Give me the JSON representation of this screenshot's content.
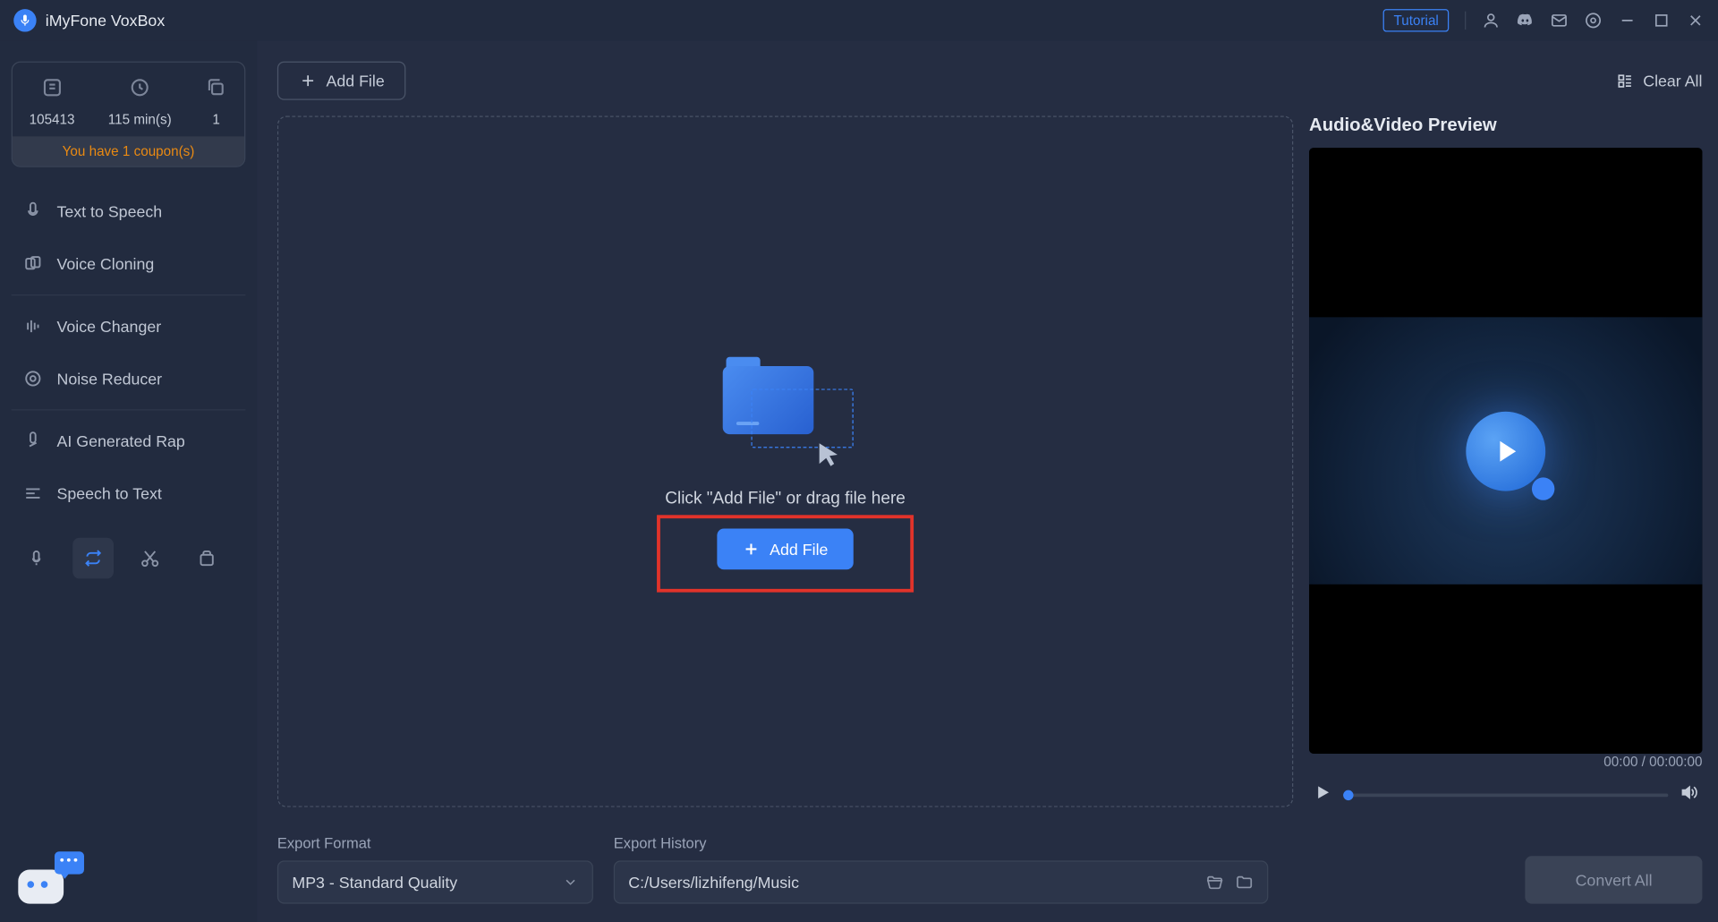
{
  "app": {
    "title": "iMyFone VoxBox"
  },
  "titlebar": {
    "tutorial": "Tutorial"
  },
  "stats": {
    "count1": "105413",
    "minutes": "115 min(s)",
    "count2": "1",
    "coupon": "You have 1 coupon(s)"
  },
  "nav": {
    "tts": "Text to Speech",
    "cloning": "Voice Cloning",
    "changer": "Voice Changer",
    "noise": "Noise Reducer",
    "rap": "AI Generated Rap",
    "stt": "Speech to Text"
  },
  "toolbar": {
    "addFile": "Add File",
    "clearAll": "Clear All"
  },
  "dropzone": {
    "hint": "Click \"Add File\" or drag file here",
    "button": "Add File"
  },
  "preview": {
    "title": "Audio&Video Preview",
    "time": "00:00 / 00:00:00"
  },
  "footer": {
    "formatLabel": "Export Format",
    "formatValue": "MP3 - Standard Quality",
    "historyLabel": "Export History",
    "historyPath": "C:/Users/lizhifeng/Music",
    "convert": "Convert All"
  }
}
